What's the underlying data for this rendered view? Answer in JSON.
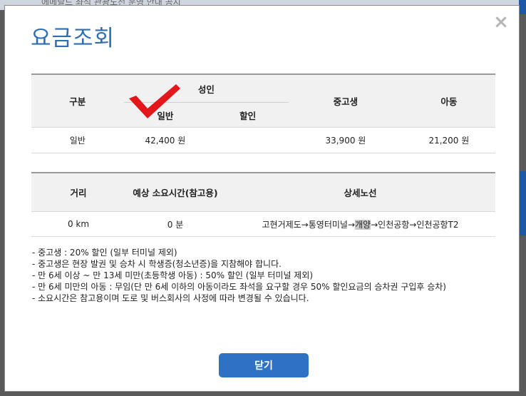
{
  "background": {
    "header_text": "에메랄드 좌석 관광노선 운영 안내 공지"
  },
  "modal": {
    "title": "요금조회",
    "close_icon": "×",
    "close_button_label": "닫기"
  },
  "fare_table": {
    "col_category": "구분",
    "col_adult": "성인",
    "col_adult_general": "일반",
    "col_adult_discount": "할인",
    "col_youth": "중고생",
    "col_child": "아동",
    "rows": [
      {
        "category": "일반",
        "adult_general": "42,400 원",
        "adult_discount": "",
        "youth": "33,900 원",
        "child": "21,200 원"
      }
    ]
  },
  "route_table": {
    "col_distance": "거리",
    "col_time": "예상 소요시간(참고용)",
    "col_route": "상세노선",
    "rows": [
      {
        "distance": "0 km",
        "time": "0 분",
        "route_before": "고현거제도→통영터미널→",
        "route_highlight": "개양",
        "route_after": "→인천공항→인천공항T2"
      }
    ]
  },
  "notes": [
    "- 중고생 : 20% 할인 (일부 터미널 제외)",
    "- 중고생은 현장 발권 및 승차 시 학생증(청소년증)을 지참해야 합니다.",
    "- 만 6세 이상 ~ 만 13세 미만(초등학생 아동) : 50% 할인 (일부 터미널 제외)",
    "- 만 6세 미만의 아동 : 무임(단 만 6세 이하의 아동이라도 좌석을 요구할 경우 50% 할인요금의 승차권 구입후 승차)",
    "- 소요시간은 참고용이며 도로 및 버스회사의 사정에 따라 변경될 수 있습니다."
  ],
  "colors": {
    "title": "#2f6eb5",
    "button": "#2f72c4",
    "checkmark": "#e3161b"
  }
}
